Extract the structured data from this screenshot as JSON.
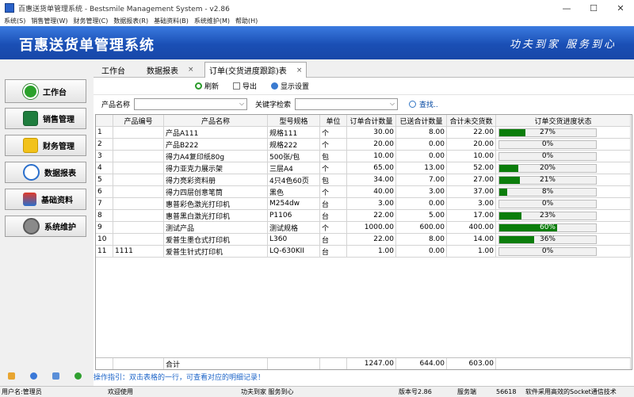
{
  "window": {
    "title": "百惠送货单管理系统 - Bestsmile Management System - v2.86",
    "minimize": "—",
    "maximize": "☐",
    "close": "✕"
  },
  "menu": [
    "系统(S)",
    "销售管理(W)",
    "财务管理(C)",
    "数据报表(R)",
    "基础资料(B)",
    "系统维护(M)",
    "帮助(H)"
  ],
  "banner": {
    "title": "百惠送货单管理系统",
    "slogan": "功夫到家 服务到心"
  },
  "sidebar": {
    "items": [
      {
        "label": "工作台",
        "icon": "check-circle-icon"
      },
      {
        "label": "销售管理",
        "icon": "sales-icon"
      },
      {
        "label": "财务管理",
        "icon": "folder-icon"
      },
      {
        "label": "数据报表",
        "icon": "magnifier-icon"
      },
      {
        "label": "基础资料",
        "icon": "building-icon"
      },
      {
        "label": "系统维护",
        "icon": "gears-icon"
      }
    ]
  },
  "tabs": [
    {
      "label": "工作台"
    },
    {
      "label": "数据报表",
      "close": "×"
    },
    {
      "label": "订单(交货进度跟踪)表",
      "close": "×"
    }
  ],
  "toolbar": {
    "refresh": "刷新",
    "export": "导出",
    "display_settings": "显示设置"
  },
  "filter": {
    "product_label": "产品名称",
    "keyword_label": "关键字检索",
    "search": "查找.."
  },
  "table": {
    "headers": [
      "",
      "产品编号",
      "产品名称",
      "型号规格",
      "单位",
      "订单合计数量",
      "已送合计数量",
      "合计未交货数",
      "订单交货进度状态"
    ],
    "rows": [
      {
        "no": "1",
        "code": "",
        "name": "产品A111",
        "spec": "规格111",
        "unit": "个",
        "ordered": "30.00",
        "delivered": "8.00",
        "pending": "22.00",
        "progress": 0.27,
        "progress_label": "27%"
      },
      {
        "no": "2",
        "code": "",
        "name": "产品B222",
        "spec": "规格222",
        "unit": "个",
        "ordered": "20.00",
        "delivered": "0.00",
        "pending": "20.00",
        "progress": 0.0,
        "progress_label": "0%"
      },
      {
        "no": "3",
        "code": "",
        "name": "得力A4复印纸80g",
        "spec": "500张/包",
        "unit": "包",
        "ordered": "10.00",
        "delivered": "0.00",
        "pending": "10.00",
        "progress": 0.0,
        "progress_label": "0%"
      },
      {
        "no": "4",
        "code": "",
        "name": "得力亚克力展示架",
        "spec": "三层A4",
        "unit": "个",
        "ordered": "65.00",
        "delivered": "13.00",
        "pending": "52.00",
        "progress": 0.2,
        "progress_label": "20%"
      },
      {
        "no": "5",
        "code": "",
        "name": "得力亮彩资料册",
        "spec": "4只4色60页",
        "unit": "包",
        "ordered": "34.00",
        "delivered": "7.00",
        "pending": "27.00",
        "progress": 0.21,
        "progress_label": "21%"
      },
      {
        "no": "6",
        "code": "",
        "name": "得力四层创意笔筒",
        "spec": "黑色",
        "unit": "个",
        "ordered": "40.00",
        "delivered": "3.00",
        "pending": "37.00",
        "progress": 0.08,
        "progress_label": "8%"
      },
      {
        "no": "7",
        "code": "",
        "name": "惠普彩色激光打印机",
        "spec": "M254dw",
        "unit": "台",
        "ordered": "3.00",
        "delivered": "0.00",
        "pending": "3.00",
        "progress": 0.0,
        "progress_label": "0%"
      },
      {
        "no": "8",
        "code": "",
        "name": "惠普黑白激光打印机",
        "spec": "P1106",
        "unit": "台",
        "ordered": "22.00",
        "delivered": "5.00",
        "pending": "17.00",
        "progress": 0.23,
        "progress_label": "23%"
      },
      {
        "no": "9",
        "code": "",
        "name": "测试产品",
        "spec": "测试规格",
        "unit": "个",
        "ordered": "1000.00",
        "delivered": "600.00",
        "pending": "400.00",
        "progress": 0.6,
        "progress_label": "60%"
      },
      {
        "no": "10",
        "code": "",
        "name": "爱普生墨仓式打印机",
        "spec": "L360",
        "unit": "台",
        "ordered": "22.00",
        "delivered": "8.00",
        "pending": "14.00",
        "progress": 0.36,
        "progress_label": "36%"
      },
      {
        "no": "11",
        "code": "1111",
        "name": "爱普生针式打印机",
        "spec": "LQ-630KII",
        "unit": "台",
        "ordered": "1.00",
        "delivered": "0.00",
        "pending": "1.00",
        "progress": 0.0,
        "progress_label": "0%"
      }
    ],
    "totals": {
      "label": "合计",
      "ordered": "1247.00",
      "delivered": "644.00",
      "pending": "603.00"
    }
  },
  "hint": "操作指引：双击表格的一行，可查看对应的明细记录！",
  "statusbar": {
    "user": "用户名:管理员",
    "welcome": "欢迎使用",
    "motto": "功夫到家 服务到心",
    "version": "版本号2.86",
    "server_label": "服务端",
    "port": "56618",
    "tech": "软件采用高效的Socket通信技术"
  },
  "colors": {
    "banner": "#1a4fb5",
    "progress": "#0b7d0b",
    "hint": "#1c64c8"
  }
}
